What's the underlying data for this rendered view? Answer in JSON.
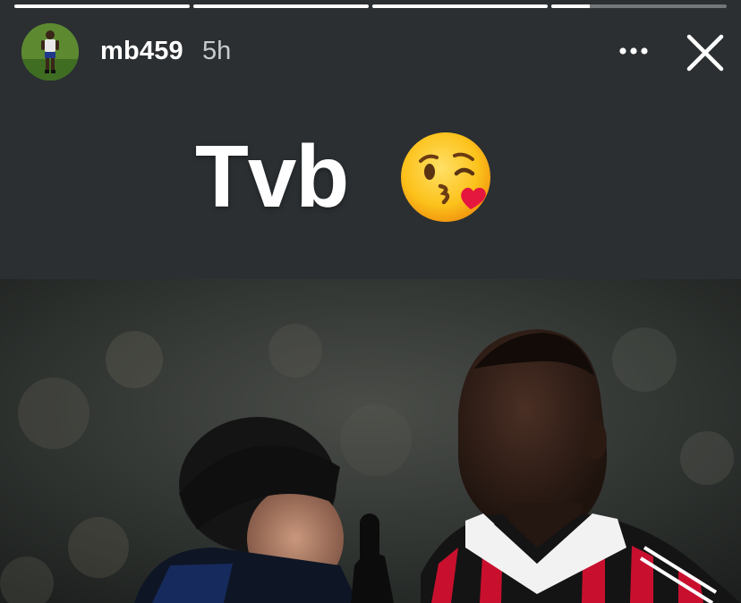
{
  "story": {
    "progress": [
      1,
      1,
      1,
      0.22
    ],
    "user": {
      "username": "mb459",
      "timestamp": "5h",
      "avatar_icon": "profile-avatar"
    },
    "caption": {
      "text": "Tvb",
      "emoji": "face-blowing-a-kiss-emoji"
    },
    "controls": {
      "more_icon": "more-options-icon",
      "close_icon": "close-icon"
    },
    "colors": {
      "background": "#2b2f32",
      "text": "#ffffff",
      "kit_red": "#c8102e",
      "kit_black": "#141414"
    }
  }
}
